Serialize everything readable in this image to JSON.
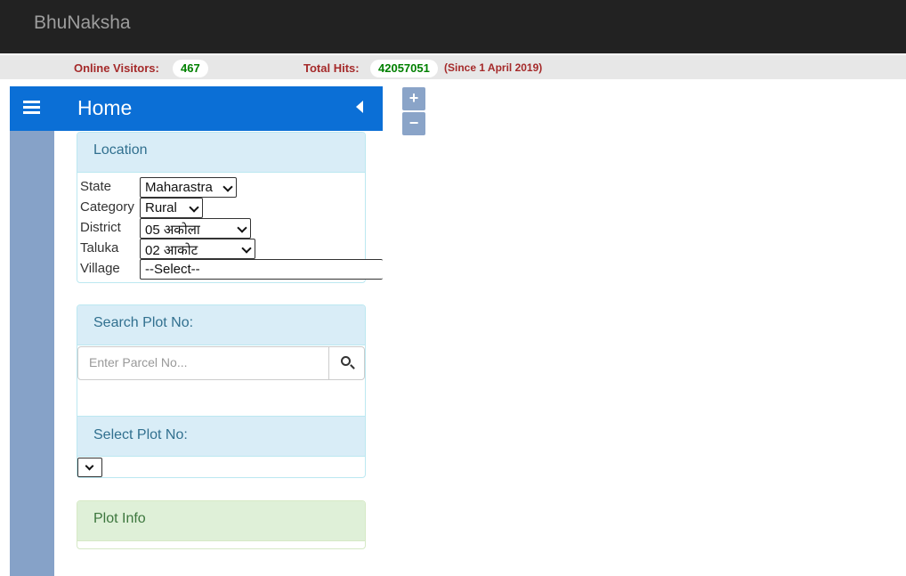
{
  "app": {
    "brand": "BhuNaksha"
  },
  "stats": {
    "online_label": "Online Visitors:",
    "online_value": "467",
    "hits_label": "Total Hits:",
    "hits_value": "42057051",
    "hits_note": "(Since 1 April 2019)"
  },
  "sidebar": {
    "title": "Home"
  },
  "location": {
    "heading": "Location",
    "fields": [
      {
        "label": "State",
        "value": "Maharastra"
      },
      {
        "label": "Category",
        "value": "Rural"
      },
      {
        "label": "District",
        "value": "05 अकोला"
      },
      {
        "label": "Taluka",
        "value": "02 आकोट"
      },
      {
        "label": "Village",
        "value": "--Select--"
      }
    ]
  },
  "search": {
    "heading": "Search Plot No:",
    "placeholder": "Enter Parcel No...",
    "select_heading": "Select Plot No:"
  },
  "plot_info": {
    "heading": "Plot Info"
  },
  "zoom": {
    "in": "+",
    "out": "−"
  },
  "icons": [
    "menu-icon",
    "collapse-left-icon",
    "search-icon",
    "chevron-down-icon"
  ]
}
